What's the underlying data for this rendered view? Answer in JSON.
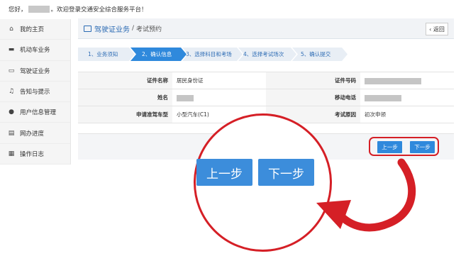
{
  "topbar": {
    "greeting": "您好，",
    "welcome": "。欢迎登录交通安全综合服务平台！"
  },
  "sidebar": {
    "items": [
      {
        "label": "我的主页",
        "icon": "home-icon"
      },
      {
        "label": "机动车业务",
        "icon": "truck-icon"
      },
      {
        "label": "驾驶证业务",
        "icon": "id-card-icon"
      },
      {
        "label": "告知与提示",
        "icon": "bell-icon"
      },
      {
        "label": "用户信息管理",
        "icon": "user-icon"
      },
      {
        "label": "网办进度",
        "icon": "progress-icon"
      },
      {
        "label": "操作日志",
        "icon": "log-icon"
      }
    ]
  },
  "header": {
    "title": "驾驶证业务",
    "separator": "/",
    "subtitle": "考试预约",
    "back_label": "‹ 返回"
  },
  "steps": [
    {
      "label": "1、业务须知",
      "state": "done"
    },
    {
      "label": "2、确认信息",
      "state": "active"
    },
    {
      "label": "3、选择科目和考场",
      "state": "todo"
    },
    {
      "label": "4、选择考试场次",
      "state": "todo"
    },
    {
      "label": "5、确认提交",
      "state": "todo"
    }
  ],
  "form": {
    "id_type_label": "证件名称",
    "id_type_value": "居民身份证",
    "id_number_label": "证件号码",
    "name_label": "姓名",
    "phone_label": "移动电话",
    "vehicle_label": "申请准驾车型",
    "vehicle_value": "小型汽车(C1)",
    "reason_label": "考试原因",
    "reason_value": "初次申领"
  },
  "actions": {
    "prev_label": "上一步",
    "next_label": "下一步"
  },
  "colors": {
    "accent": "#2f89dc",
    "step_active": "#2f89dc",
    "step_inactive": "#e8eef5",
    "highlight": "#d51f26"
  }
}
